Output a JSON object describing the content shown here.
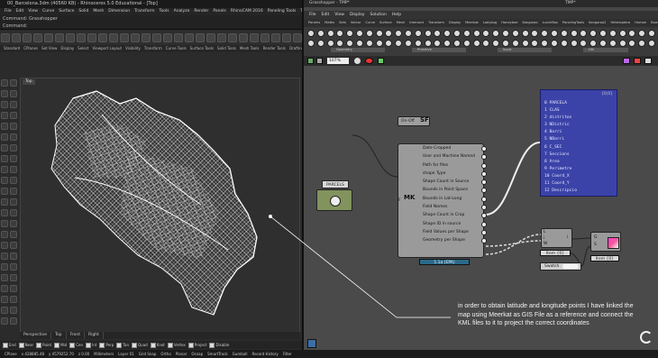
{
  "rhino": {
    "title": "00_Barcelona.3dm (40560 KB) - Rhinoceros 5.0 Educational - [Top]",
    "menu": [
      "File",
      "Edit",
      "View",
      "Curve",
      "Surface",
      "Solid",
      "Mesh",
      "Dimension",
      "Transform",
      "Tools",
      "Analyze",
      "Render",
      "Panels",
      "RhinoCAM 2016",
      "Paneling Tools",
      "T-Splines",
      "Help"
    ],
    "command_history": "Command: Grasshopper",
    "command_prompt": "Command:",
    "tabs": [
      "Standard",
      "CPlanes",
      "Set View",
      "Display",
      "Select",
      "Viewport Layout",
      "Visibility",
      "Transform",
      "Curve Tools",
      "Surface Tools",
      "Solid Tools",
      "Mesh Tools",
      "Render Tools",
      "Drafting"
    ],
    "viewport_label": "Top",
    "view_tabs": [
      "Perspective",
      "Top",
      "Front",
      "Right"
    ],
    "osnaps": [
      "End",
      "Near",
      "Point",
      "Mid",
      "Cen",
      "Int",
      "Perp",
      "Tan",
      "Quad",
      "Knot",
      "Vertex",
      "Project",
      "Disable"
    ],
    "status": [
      "CPlane",
      "x 428885.48",
      "y 4579252.70",
      "z 0.00",
      "Millimeters",
      "Layer 01",
      "Grid Snap",
      "Ortho",
      "Planar",
      "Osnap",
      "SmartTrack",
      "Gumball",
      "Record History",
      "Filter"
    ]
  },
  "gh": {
    "title": "Grasshopper - TMP*",
    "title_right": "TMP*",
    "menu": [
      "File",
      "Edit",
      "View",
      "Display",
      "Solution",
      "Help"
    ],
    "tabs": [
      "Params",
      "Maths",
      "Sets",
      "Vector",
      "Curve",
      "Surface",
      "Mesh",
      "Intersect",
      "Transform",
      "Display",
      "Meerkat",
      "Ladybug",
      "Honeybee",
      "Kangaroo",
      "LunchBox",
      "PanelingTools",
      "Kangaroo2",
      "Heteroptera",
      "Human",
      "Bowerbird",
      "Elk"
    ],
    "ribbon_groups": [
      "Geometry",
      "Primitive",
      "Input",
      "Util"
    ],
    "zoom": "107%",
    "onoff_label": "On-Off",
    "onoff_symbol": "SF",
    "file_panel_label": "PARCELS",
    "meerkat": {
      "label": "MK",
      "input": "F",
      "outputs": [
        "Date Cropped",
        "User and Machine Named",
        "Path for files",
        "shape Type",
        "Shape Count in Source",
        "Bounds in Point Space",
        "Bounds in Lat-Long",
        "Field Names",
        "Shape Count in Crop",
        "Shape ID in source",
        "Field Values per Shape",
        "Geometry per Shape"
      ],
      "footer": "1.1a (EPA)"
    },
    "field_panel": {
      "header": "{0;0}",
      "rows": [
        "0 PARCELA",
        "1 CLAS",
        "2 distritos",
        "3 NDistric",
        "4 Barri",
        "5 NBarri",
        "6 C_SEC",
        "7 Seccions",
        "8 Area",
        "9 Perimetre",
        "10 Coord_X",
        "11 Coord_Y",
        "12 Descripcio"
      ]
    },
    "list_item": {
      "in_l": "L",
      "in_i": "i",
      "in_w": "W",
      "out": "i",
      "footer": "Item {0}"
    },
    "preview": {
      "in_g": "G",
      "in_s": "S",
      "footer": "Item {0}"
    },
    "swatch_label": "Swatch",
    "annotation": "in order to obtain latitude and longitude points I have linked the map using Meerkat as GIS File as a reference and connect the KML files to it to project the correct coordinates",
    "footer_version": "0.9.0076"
  }
}
